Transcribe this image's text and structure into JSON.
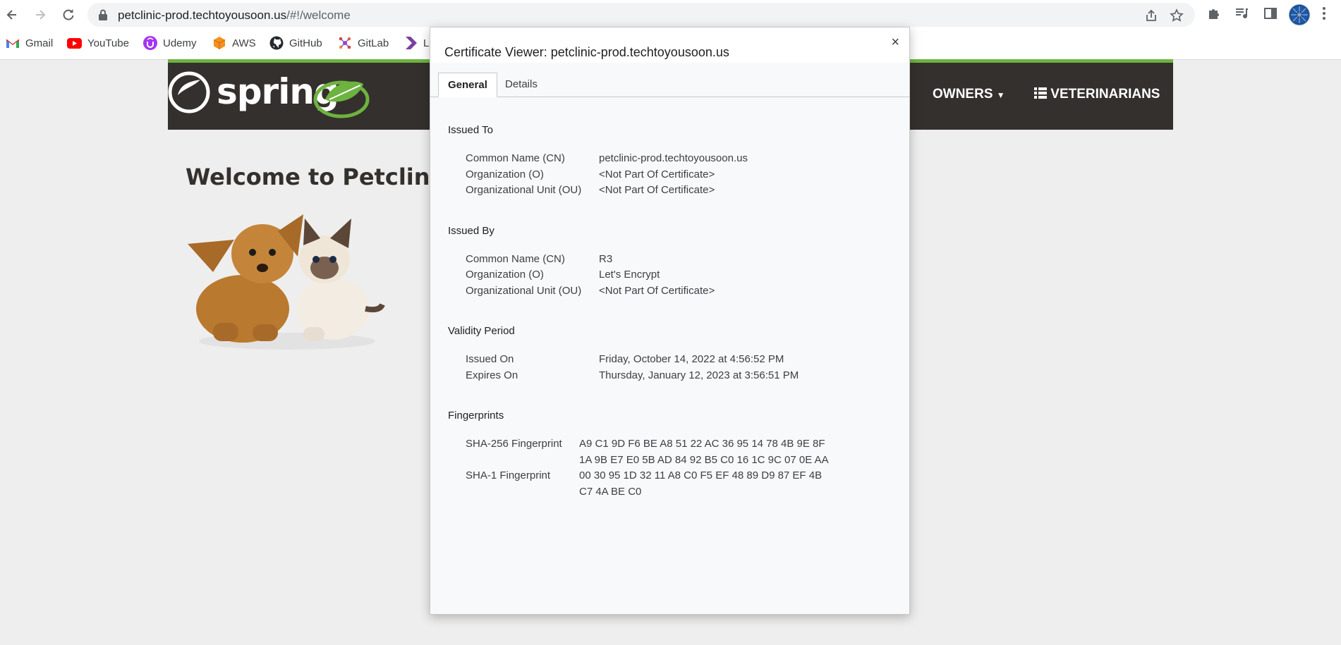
{
  "browser": {
    "url_host": "petclinic-prod.techtoyousoon.us",
    "url_rest": "/#!/welcome",
    "bookmarks": [
      {
        "label": "Gmail",
        "icon": "gmail-icon"
      },
      {
        "label": "YouTube",
        "icon": "youtube-icon"
      },
      {
        "label": "Udemy",
        "icon": "udemy-icon"
      },
      {
        "label": "AWS",
        "icon": "aws-icon"
      },
      {
        "label": "GitHub",
        "icon": "github-icon"
      },
      {
        "label": "GitLab",
        "icon": "gitlab-icon"
      },
      {
        "label": "L",
        "icon": "bookmark-chevron-icon"
      }
    ]
  },
  "site": {
    "brand": "spring",
    "nav": {
      "owners": "OWNERS",
      "veterinarians": "VETERINARIANS"
    },
    "welcome": "Welcome to Petclinic"
  },
  "dialog": {
    "title": "Certificate Viewer: petclinic-prod.techtoyousoon.us",
    "close": "×",
    "tabs": [
      "General",
      "Details"
    ],
    "issued_to": {
      "heading": "Issued To",
      "rows": [
        {
          "label": "Common Name (CN)",
          "value": "petclinic-prod.techtoyousoon.us"
        },
        {
          "label": "Organization (O)",
          "value": "<Not Part Of Certificate>"
        },
        {
          "label": "Organizational Unit (OU)",
          "value": "<Not Part Of Certificate>"
        }
      ]
    },
    "issued_by": {
      "heading": "Issued By",
      "rows": [
        {
          "label": "Common Name (CN)",
          "value": "R3"
        },
        {
          "label": "Organization (O)",
          "value": "Let's Encrypt"
        },
        {
          "label": "Organizational Unit (OU)",
          "value": "<Not Part Of Certificate>"
        }
      ]
    },
    "validity": {
      "heading": "Validity Period",
      "rows": [
        {
          "label": "Issued On",
          "value": "Friday, October 14, 2022 at 4:56:52 PM"
        },
        {
          "label": "Expires On",
          "value": "Thursday, January 12, 2023 at 3:56:51 PM"
        }
      ]
    },
    "fingerprints": {
      "heading": "Fingerprints",
      "sha256_label": "SHA-256 Fingerprint",
      "sha256_line1": "A9 C1 9D F6 BE A8 51 22 AC 36 95 14 78 4B 9E 8F",
      "sha256_line2": "1A 9B E7 E0 5B AD 84 92 B5 C0 16 1C 9C 07 0E AA",
      "sha1_label": "SHA-1 Fingerprint",
      "sha1_line1": "00 30 95 1D 32 11 A8 C0 F5 EF 48 89 D9 87 EF 4B",
      "sha1_line2": "C7 4A BE C0"
    }
  }
}
